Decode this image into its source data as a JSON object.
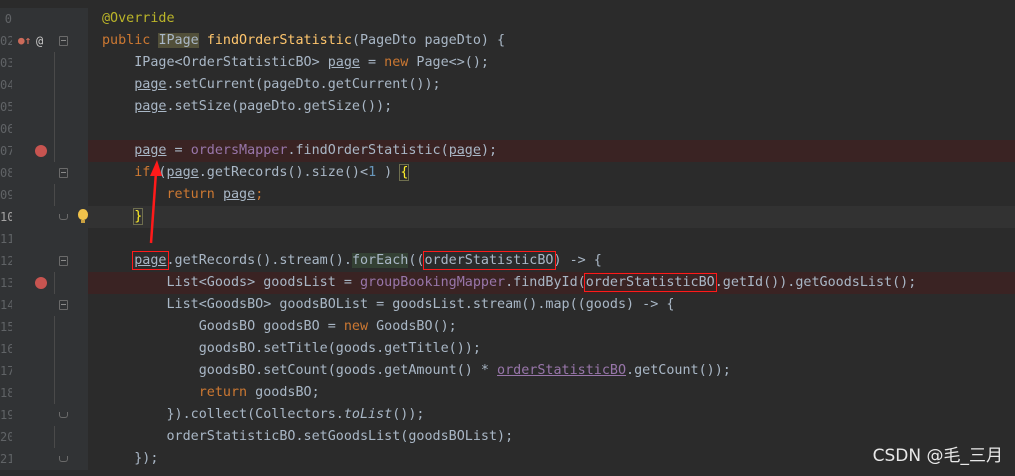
{
  "editor": {
    "language": "java",
    "lines": [
      {
        "n": "0",
        "annotation": "@Override"
      },
      {
        "n": "02",
        "kw_public": "public ",
        "ret_type": "IPage",
        "sp": " ",
        "method": "findOrderStatistic",
        "rest": "(PageDto pageDto) {"
      },
      {
        "n": "03",
        "a": "    IPage<OrderStatisticBO> ",
        "var": "page",
        "eq": " = ",
        "kw_new": "new",
        "b": " Page<>();"
      },
      {
        "n": "04",
        "indent": "    ",
        "var": "page",
        "rest": ".setCurrent(pageDto.getCurrent());"
      },
      {
        "n": "05",
        "indent": "    ",
        "var": "page",
        "rest": ".setSize(pageDto.getSize());"
      },
      {
        "n": "06"
      },
      {
        "n": "07",
        "indent": "    ",
        "var": "page",
        "eq": " = ",
        "mapper": "ordersMapper",
        "call": ".findOrderStatistic(",
        "arg": "page",
        "end": ");"
      },
      {
        "n": "08",
        "indent": "    ",
        "kw_if": "if",
        "a": " (",
        "var": "page",
        "b": ".getRecords().size()<",
        "num": "1",
        "c": " ) ",
        "brace": "{"
      },
      {
        "n": "09",
        "indent": "        ",
        "kw_return": "return",
        "sp": " ",
        "var": "page",
        "end": ";"
      },
      {
        "n": "10",
        "indent": "    ",
        "brace": "}"
      },
      {
        "n": "11"
      },
      {
        "n": "12",
        "indent": "    ",
        "var": "page",
        "a": ".getRecords().stream().",
        "foreach": "forEach",
        "b": "((",
        "param": "orderStatisticBO",
        "c": ") -> {"
      },
      {
        "n": "13",
        "a": "        List<Goods> goodsList = ",
        "mapper": "groupBookingMapper",
        "b": ".findById(",
        "param": "orderStatisticBO",
        "c": ".getId()).getGoodsList();"
      },
      {
        "n": "14",
        "text": "        List<GoodsBO> goodsBOList = goodsList.stream().map((goods) -> {"
      },
      {
        "n": "15",
        "a": "            GoodsBO goodsBO = ",
        "kw_new": "new",
        "b": " GoodsBO();"
      },
      {
        "n": "16",
        "text": "            goodsBO.setTitle(goods.getTitle());"
      },
      {
        "n": "17",
        "a": "            goodsBO.setCount(goods.getAmount() * ",
        "captured": "orderStatisticBO",
        "b": ".getCount());"
      },
      {
        "n": "18",
        "indent": "            ",
        "kw_return": "return",
        "rest": " goodsBO;"
      },
      {
        "n": "19",
        "a": "        }).collect(Collectors.",
        "static_call": "toList",
        "b": "());"
      },
      {
        "n": "20",
        "text": "        orderStatisticBO.setGoodsList(goodsBOList);"
      },
      {
        "n": "21",
        "text": "    });"
      }
    ]
  },
  "colors": {
    "background": "#2b2b2b",
    "gutter": "#313335",
    "breakpoint": "#c75450",
    "keyword": "#cc7832",
    "method_decl": "#ffc66d",
    "field": "#9876aa",
    "number": "#6897bb",
    "annotation": "#bbb529",
    "markup_red": "#ff1a1a"
  },
  "watermark": "CSDN @毛_三月"
}
